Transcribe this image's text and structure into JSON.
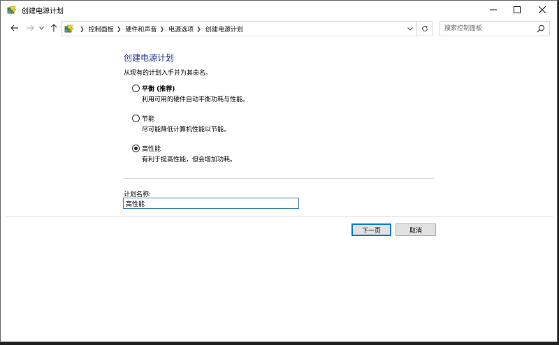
{
  "window": {
    "title": "创建电源计划"
  },
  "nav": {
    "breadcrumbs": [
      "控制面板",
      "硬件和声音",
      "电源选项",
      "创建电源计划"
    ],
    "search_placeholder": "搜索控制面板"
  },
  "main": {
    "title": "创建电源计划",
    "subtitle": "从现有的计划入手并为其命名。",
    "plans": [
      {
        "label": "平衡 (推荐)",
        "description": "利用可用的硬件自动平衡功耗与性能。",
        "selected": false
      },
      {
        "label": "节能",
        "description": "尽可能降低计算机性能以节能。",
        "selected": false
      },
      {
        "label": "高性能",
        "description": "有利于提高性能，但会增加功耗。",
        "selected": true
      }
    ],
    "name_label": "计划名称:",
    "name_value": "高性能"
  },
  "buttons": {
    "next": "下一页",
    "cancel": "取消"
  },
  "icons": {
    "app": "power-options-icon",
    "back": "back-arrow-icon",
    "forward": "forward-arrow-icon",
    "recent": "chevron-down-icon",
    "up": "up-arrow-icon",
    "refresh": "refresh-icon",
    "search": "search-icon"
  }
}
